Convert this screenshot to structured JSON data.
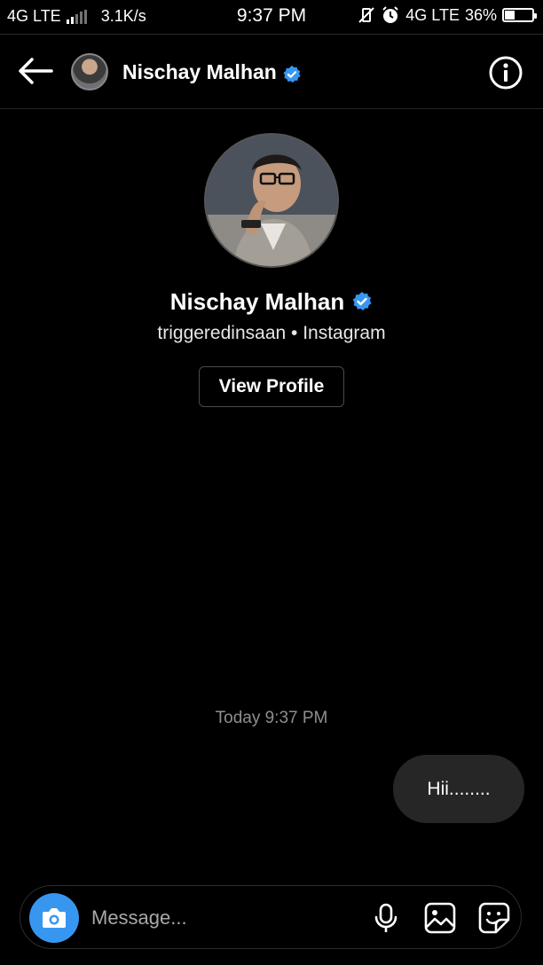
{
  "status_bar": {
    "network_left": "4G LTE",
    "speed": "3.1K/s",
    "time": "9:37 PM",
    "network_right": "4G LTE",
    "battery_percent": "36%",
    "battery_level": 0.36
  },
  "header": {
    "name": "Nischay Malhan",
    "back_icon": "arrow-left-icon",
    "info_icon": "info-icon"
  },
  "profile": {
    "name": "Nischay Malhan",
    "subtitle": "triggeredinsaan • Instagram",
    "view_profile_label": "View Profile"
  },
  "conversation": {
    "timestamp": "Today 9:37 PM",
    "messages": [
      {
        "sender": "me",
        "text": "Hii........"
      }
    ]
  },
  "composer": {
    "placeholder": "Message...",
    "icons": [
      "camera-icon",
      "microphone-icon",
      "gallery-icon",
      "sticker-icon"
    ]
  },
  "colors": {
    "background": "#000000",
    "accent": "#3797f0",
    "bubble": "#262626",
    "muted_text": "#8e8e8e"
  }
}
